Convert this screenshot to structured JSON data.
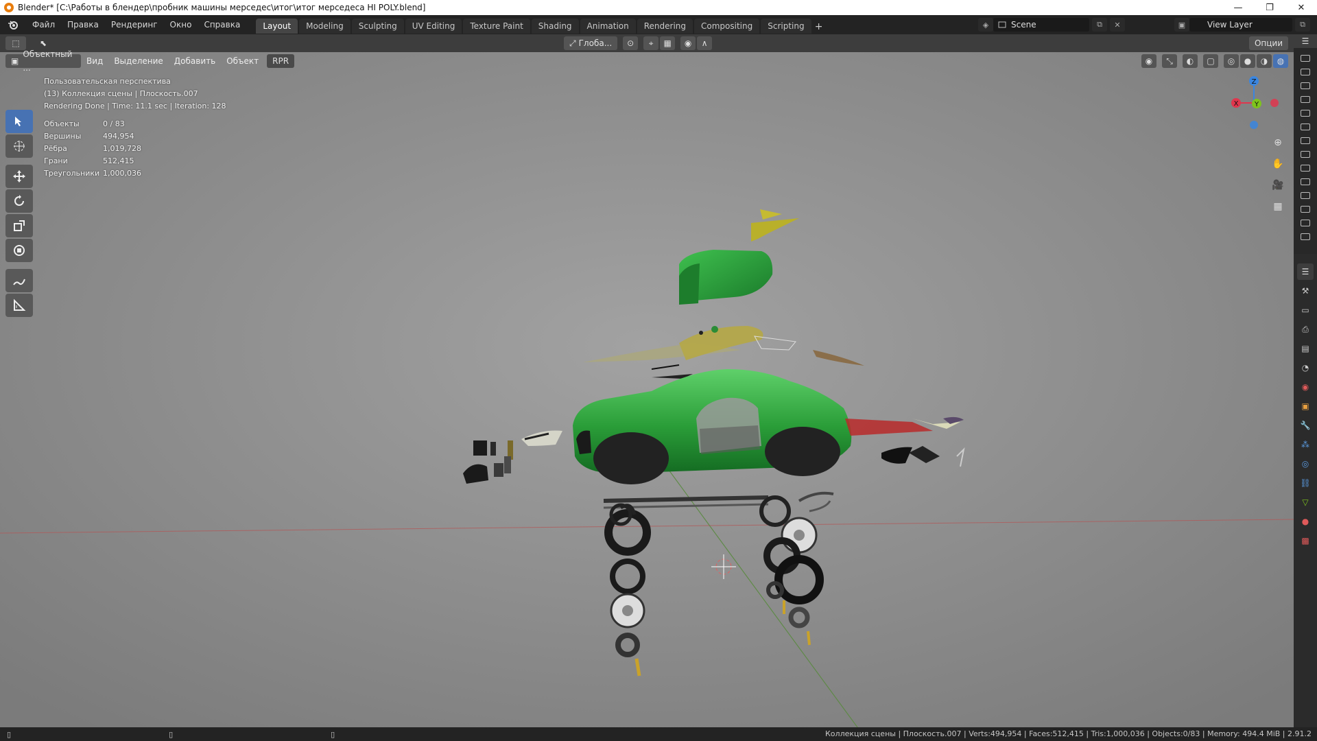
{
  "window": {
    "title": "Blender* [C:\\Работы в блендер\\пробник машины мерседес\\итог\\итог мерседеса HI POLY.blend]",
    "minimize": "—",
    "restore": "❐",
    "close": "✕"
  },
  "menu": [
    "Файл",
    "Правка",
    "Рендеринг",
    "Окно",
    "Справка"
  ],
  "workspaces": [
    "Layout",
    "Modeling",
    "Sculpting",
    "UV Editing",
    "Texture Paint",
    "Shading",
    "Animation",
    "Rendering",
    "Compositing",
    "Scripting"
  ],
  "active_workspace": "Layout",
  "add_workspace": "+",
  "scene": "Scene",
  "view_layer": "View Layer",
  "viewport_header": {
    "transform_orientation": "Глоба...",
    "options": "Опции"
  },
  "viewport_menu": {
    "mode": "Объектный ...",
    "view": "Вид",
    "select": "Выделение",
    "add": "Добавить",
    "object": "Объект",
    "rpr": "RPR"
  },
  "overlay": {
    "perspective": "Пользовательская перспектива",
    "collection": "(13) Коллекция сцены | Плоскость.007",
    "render_status": "Rendering Done | Time: 11.1 sec | Iteration: 128"
  },
  "stats": [
    {
      "label": "Объекты",
      "value": "0 / 83"
    },
    {
      "label": "Вершины",
      "value": "494,954"
    },
    {
      "label": "Рёбра",
      "value": "1,019,728"
    },
    {
      "label": "Грани",
      "value": "512,415"
    },
    {
      "label": "Треугольники",
      "value": "1,000,036"
    }
  ],
  "gizmo": {
    "x": "X",
    "y": "Y",
    "z": "Z"
  },
  "colors": {
    "x_axis": "#e0364d",
    "y_axis": "#7ec41d",
    "z_axis": "#3a86e0",
    "active_tool": "#4772b3",
    "car_green": "#2fa43a",
    "viewport_bg": "#828282"
  },
  "statusbar": {
    "right": "Коллекция сцены | Плоскость.007 | Verts:494,954 | Faces:512,415 | Tris:1,000,036 | Objects:0/83 | Memory: 494.4 MiB | 2.91.2"
  }
}
